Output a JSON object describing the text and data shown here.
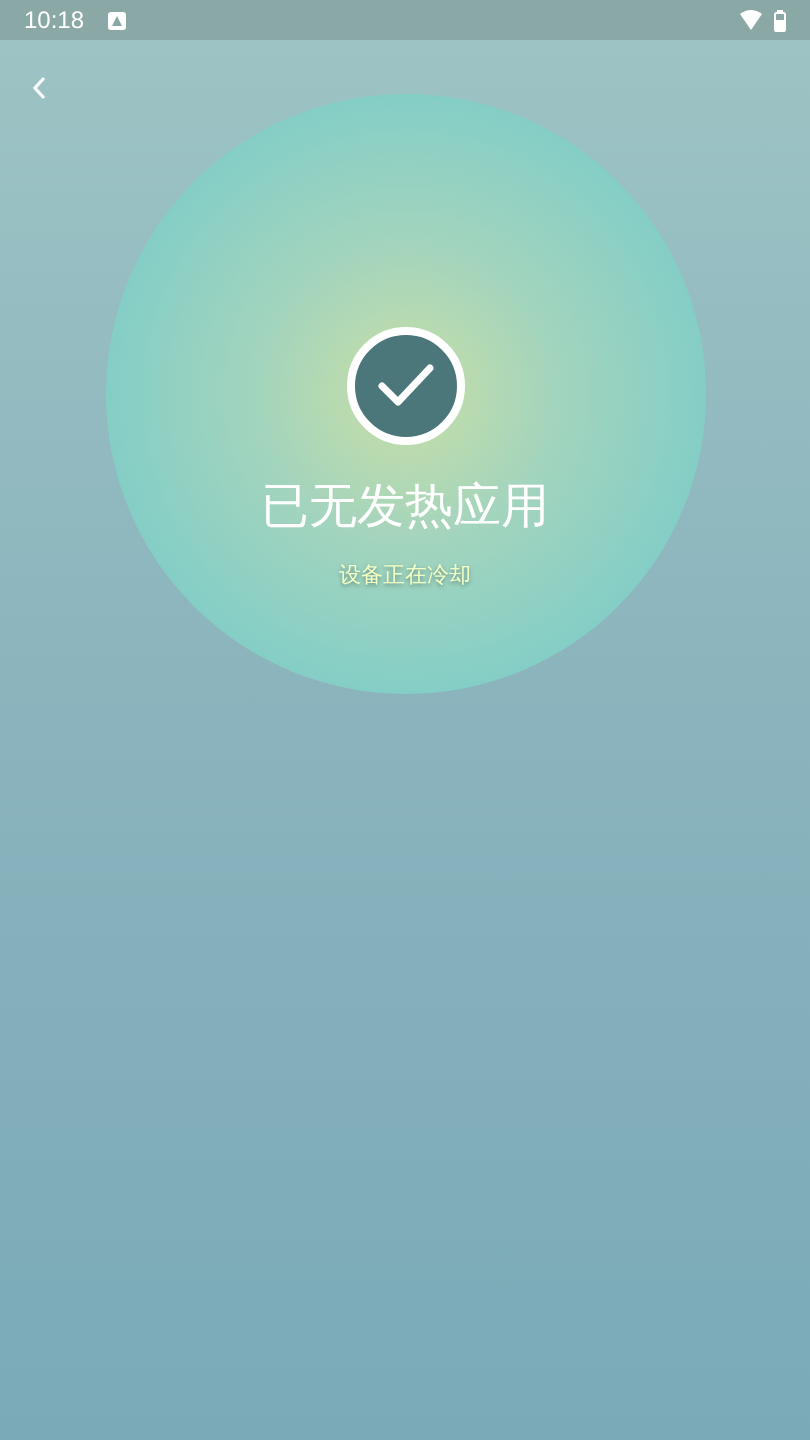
{
  "status_bar": {
    "time": "10:18"
  },
  "result": {
    "title": "已无发热应用",
    "subtitle": "设备正在冷却"
  }
}
